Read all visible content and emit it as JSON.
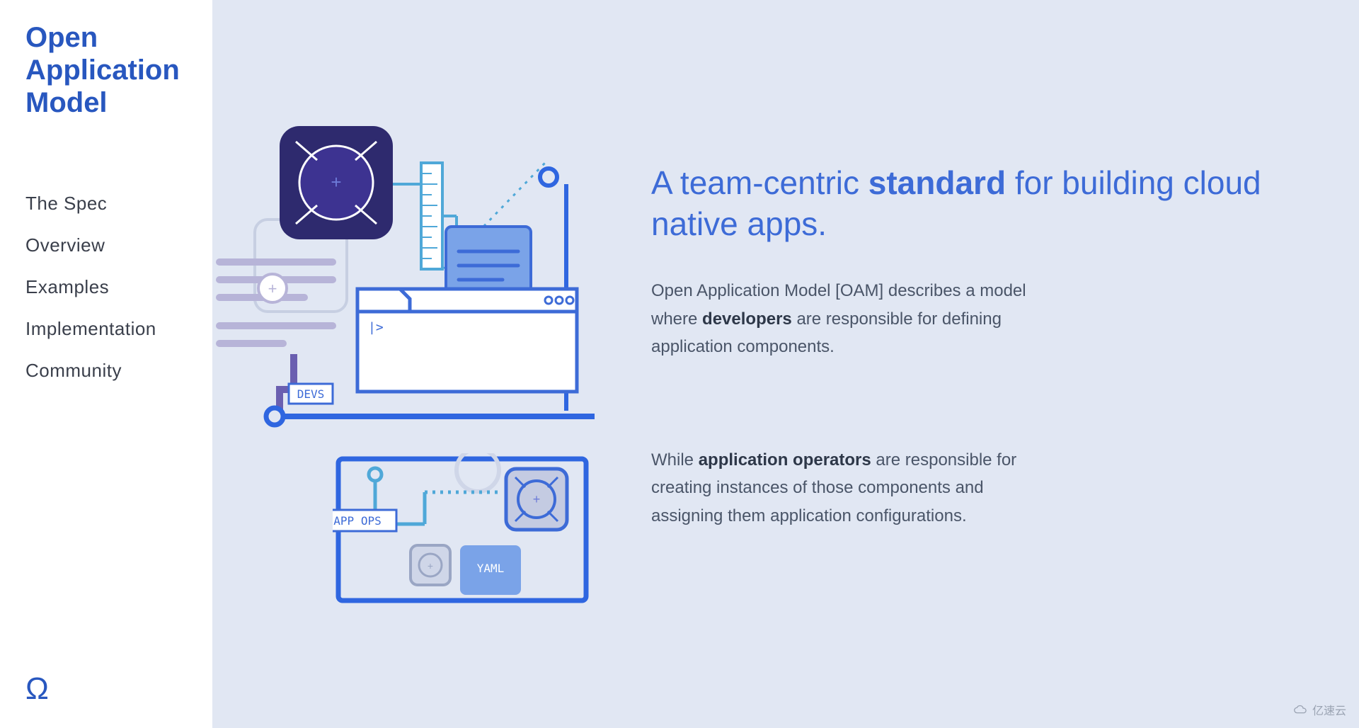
{
  "site_title": "Open Application Model",
  "nav": [
    {
      "label": "The Spec"
    },
    {
      "label": "Overview"
    },
    {
      "label": "Examples"
    },
    {
      "label": "Implementation"
    },
    {
      "label": "Community"
    }
  ],
  "omega_glyph": "Ω",
  "headline_prefix": "A team-centric ",
  "headline_bold": "standard",
  "headline_suffix": " for building cloud native apps.",
  "para1_prefix": "Open Application Model [OAM] describes a model where ",
  "para1_bold": "developers",
  "para1_suffix": " are responsible for defining application components.",
  "para2_prefix": "While ",
  "para2_bold": "application operators",
  "para2_suffix": " are responsible for creating instances of those components and assigning them application configurations.",
  "illus": {
    "devs_label": "DEVS",
    "appops_label": "APP OPS",
    "yaml_label": "YAML",
    "prompt": "|>"
  },
  "watermark_text": "亿速云"
}
